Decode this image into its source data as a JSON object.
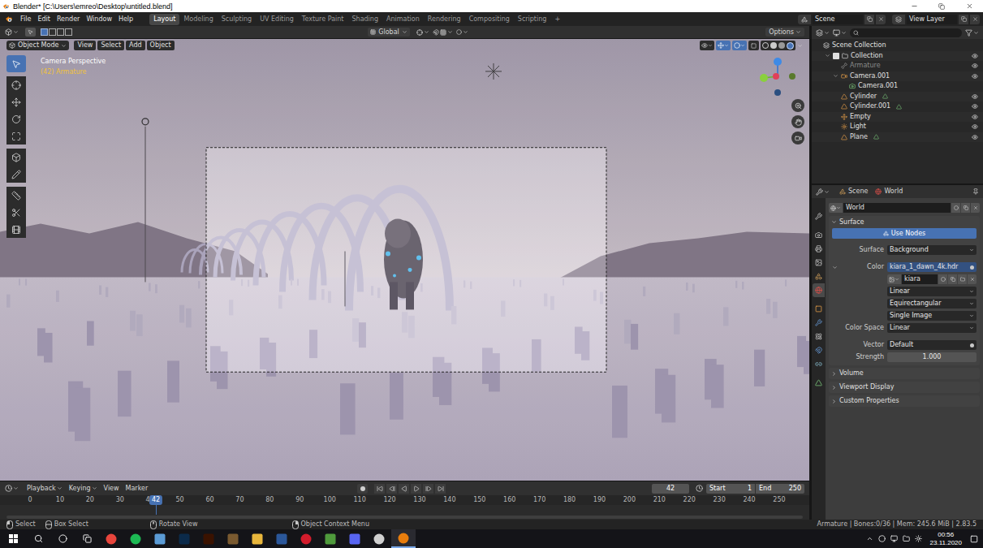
{
  "window": {
    "title": "Blender* [C:\\Users\\emreo\\Desktop\\untitled.blend]"
  },
  "menu": [
    "File",
    "Edit",
    "Render",
    "Window",
    "Help"
  ],
  "workspaces": [
    {
      "label": "Layout",
      "selected": true
    },
    {
      "label": "Modeling",
      "selected": false
    },
    {
      "label": "Sculpting",
      "selected": false
    },
    {
      "label": "UV Editing",
      "selected": false
    },
    {
      "label": "Texture Paint",
      "selected": false
    },
    {
      "label": "Shading",
      "selected": false
    },
    {
      "label": "Animation",
      "selected": false
    },
    {
      "label": "Rendering",
      "selected": false
    },
    {
      "label": "Compositing",
      "selected": false
    },
    {
      "label": "Scripting",
      "selected": false
    },
    {
      "label": "+",
      "selected": false
    }
  ],
  "scene": {
    "label": "Scene"
  },
  "view_layer": {
    "label": "View Layer"
  },
  "tool_header": {
    "orientation": "Global",
    "options": "Options"
  },
  "viewport_header": {
    "mode": "Object Mode",
    "menus": [
      "View",
      "Select",
      "Add",
      "Object"
    ]
  },
  "viewport": {
    "view_name": "Camera Perspective",
    "active_object": "(42) Armature"
  },
  "tools": [
    {
      "selected": true
    },
    {
      "selected": false
    },
    {
      "selected": false
    },
    {
      "selected": false
    },
    {
      "selected": false
    },
    {
      "selected": false
    },
    {
      "selected": false
    },
    {
      "selected": false
    },
    {
      "selected": false
    },
    {
      "selected": false
    }
  ],
  "outliner": {
    "root": "Scene Collection",
    "items": [
      {
        "name": "Collection",
        "kind": "collection",
        "expanded": true,
        "dimmed": false,
        "checked": true,
        "visible": true,
        "children": [
          {
            "name": "Armature",
            "kind": "armature",
            "expanded": false,
            "dimmed": true,
            "visible": true,
            "children": []
          },
          {
            "name": "Camera.001",
            "kind": "camera",
            "expanded": true,
            "dimmed": false,
            "visible": true,
            "children": [
              {
                "name": "Camera.001",
                "kind": "camera-data",
                "expanded": false,
                "dimmed": false,
                "children": []
              }
            ]
          },
          {
            "name": "Cylinder",
            "kind": "mesh",
            "expanded": false,
            "dimmed": false,
            "visible": true,
            "children": []
          },
          {
            "name": "Cylinder.001",
            "kind": "mesh",
            "expanded": false,
            "dimmed": false,
            "visible": true,
            "children": []
          },
          {
            "name": "Empty",
            "kind": "empty",
            "expanded": false,
            "dimmed": false,
            "visible": true,
            "children": []
          },
          {
            "name": "Light",
            "kind": "light",
            "expanded": false,
            "dimmed": false,
            "visible": true,
            "children": []
          },
          {
            "name": "Plane",
            "kind": "mesh",
            "expanded": false,
            "dimmed": false,
            "visible": true,
            "children": []
          }
        ]
      }
    ]
  },
  "properties": {
    "breadcrumb": [
      "Scene",
      "World"
    ],
    "datablock": "World",
    "tabs": [
      {
        "selected": false
      },
      {
        "selected": false
      },
      {
        "selected": false
      },
      {
        "selected": false
      },
      {
        "selected": false
      },
      {
        "selected": true
      },
      {
        "selected": false
      },
      {
        "selected": false
      },
      {
        "selected": false
      },
      {
        "selected": false
      },
      {
        "selected": false
      },
      {
        "selected": false
      }
    ],
    "surface_panel": {
      "title": "Surface",
      "expanded": true
    },
    "use_nodes": {
      "label": "Use Nodes",
      "on": true
    },
    "rows": [
      {
        "kind": "dropdown",
        "label": "Surface",
        "value": "Background"
      },
      {
        "kind": "link",
        "label": "Color",
        "value": "kiara_1_dawn_4k.hdr",
        "expanded": true
      },
      {
        "kind": "image",
        "value": "kiara"
      },
      {
        "kind": "dropdown",
        "value": "Linear"
      },
      {
        "kind": "dropdown",
        "value": "Equirectangular"
      },
      {
        "kind": "dropdown",
        "value": "Single Image"
      },
      {
        "kind": "dropdown",
        "label": "Color Space",
        "value": "Linear"
      },
      {
        "kind": "field",
        "label": "Vector",
        "value": "Default"
      },
      {
        "kind": "number",
        "label": "Strength",
        "value": "1.000"
      }
    ],
    "collapsed_panels": [
      {
        "title": "Volume",
        "expanded": false
      },
      {
        "title": "Viewport Display",
        "expanded": false
      },
      {
        "title": "Custom Properties",
        "expanded": false
      }
    ]
  },
  "timeline": {
    "menus": [
      "Playback",
      "Keying",
      "View",
      "Marker"
    ],
    "current_frame": "42",
    "start": {
      "label": "Start",
      "value": "1"
    },
    "end": {
      "label": "End",
      "value": "250"
    },
    "ticks": [
      "0",
      "10",
      "20",
      "30",
      "40",
      "50",
      "60",
      "70",
      "80",
      "90",
      "100",
      "110",
      "120",
      "130",
      "140",
      "150",
      "160",
      "170",
      "180",
      "190",
      "200",
      "210",
      "220",
      "230",
      "240",
      "250"
    ],
    "playhead": {
      "frame": "42"
    }
  },
  "status_bar": {
    "hints": [
      "Select",
      "Box Select",
      "Rotate View",
      "Object Context Menu"
    ],
    "stats": "Armature | Bones:0/36 | Mem: 245.6 MiB | 2.83.5"
  },
  "taskbar": {
    "time": "00:56",
    "date": "23.11.2020"
  }
}
